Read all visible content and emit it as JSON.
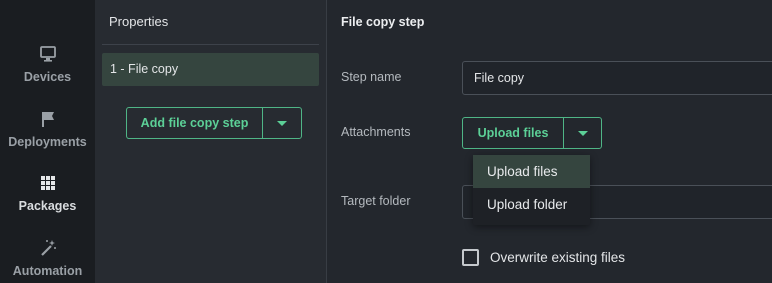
{
  "nav": {
    "items": [
      {
        "label": "Devices",
        "icon": "monitor-icon"
      },
      {
        "label": "Deployments",
        "icon": "flag-icon"
      },
      {
        "label": "Packages",
        "icon": "grid-icon"
      },
      {
        "label": "Automation",
        "icon": "magic-wand-icon"
      }
    ],
    "active": "Packages"
  },
  "properties": {
    "title": "Properties",
    "steps": [
      "1 - File copy"
    ],
    "add_button_label": "Add file copy step"
  },
  "file_copy_step": {
    "title": "File copy step",
    "step_name_label": "Step name",
    "step_name_value": "File copy",
    "attachments_label": "Attachments",
    "upload_button_label": "Upload files",
    "upload_menu": [
      "Upload files",
      "Upload folder"
    ],
    "target_folder_label": "Target folder",
    "target_folder_value": "",
    "overwrite_label": "Overwrite existing files",
    "overwrite_checked": false
  },
  "colors": {
    "accent": "#5cd097",
    "selected_bg": "#35453f",
    "nav_bg": "#1a1d21"
  }
}
